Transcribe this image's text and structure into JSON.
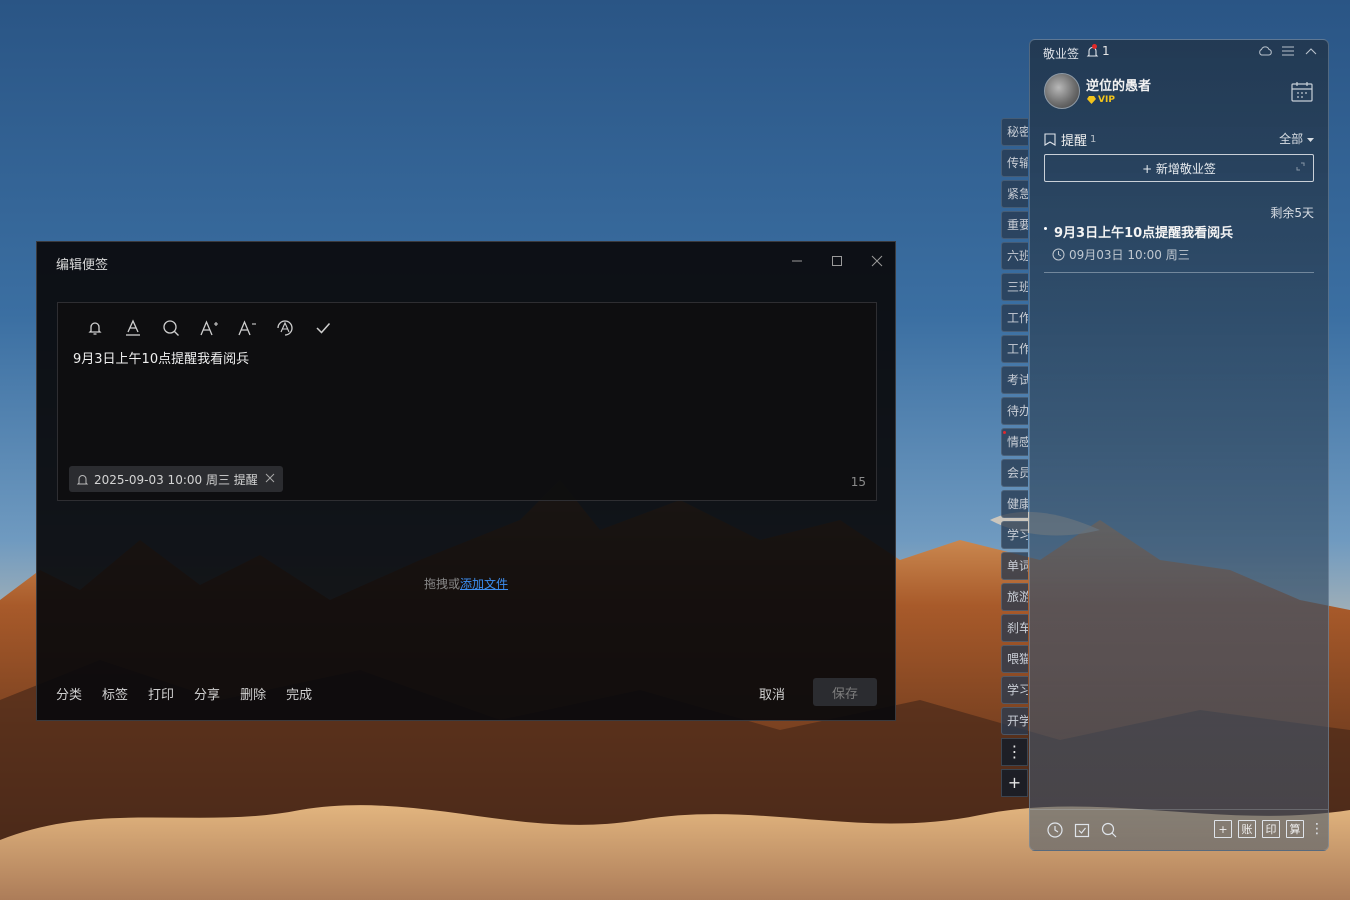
{
  "editor": {
    "title": "编辑便签",
    "minimize": "—",
    "maximize": "☐",
    "close": "✕",
    "content": "9月3日上午10点提醒我看阅兵",
    "reminder_chip": "2025-09-03 10:00 周三 提醒",
    "char_count": "15",
    "drop_text": "拖拽或",
    "drop_link": "添加文件",
    "actions": [
      "分类",
      "标签",
      "打印",
      "分享",
      "删除",
      "完成"
    ],
    "cancel": "取消",
    "save": "保存"
  },
  "category_tabs": [
    "秘密",
    "传输",
    "紧急",
    "重要",
    "六班",
    "三班",
    "工作",
    "工作",
    "考试",
    "待办",
    "情感",
    "会员",
    "健康",
    "学习",
    "单词",
    "旅游",
    "刹车",
    "喂猫",
    "学习",
    "开学"
  ],
  "strip_buttons": {
    "more": "⋮",
    "add": "+"
  },
  "panel": {
    "app_name": "敬业签",
    "notification_count": "1",
    "username": "逆位的愚者",
    "vip": "VIP",
    "section_title": "提醒",
    "section_count": "1",
    "filter": "全部",
    "new_note": "+ 新增敬业签",
    "note": {
      "remaining": "剩余5天",
      "title": "9月3日上午10点提醒我看阅兵",
      "time": "09月03日 10:00 周三"
    },
    "bottom_buttons": [
      "+",
      "账",
      "印",
      "算"
    ]
  }
}
